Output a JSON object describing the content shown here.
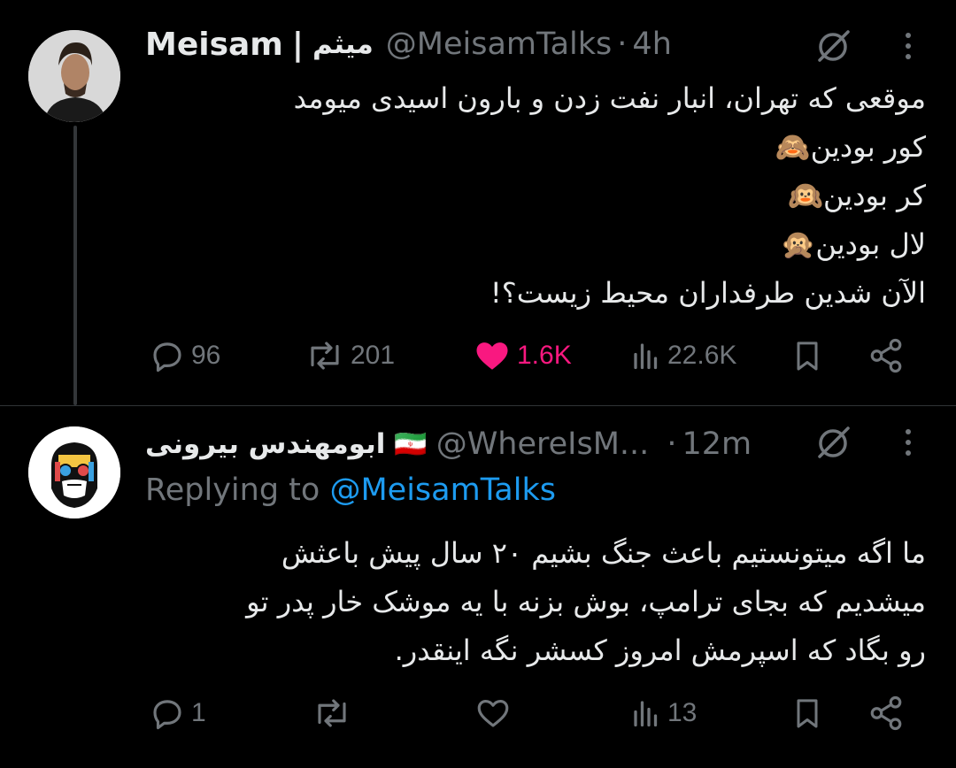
{
  "tweet_main": {
    "display_name": "Meisam",
    "separator": "|",
    "display_name_fa": "میثم",
    "handle": "@MeisamTalks",
    "dot": "·",
    "time": "4h",
    "lines": [
      "موقعی که تهران، انبار نفت زدن و بارون اسیدی میومد",
      "کور بودین🙈",
      "کر بودین🙉",
      "لال بودین🙊",
      "الآن شدین طرفداران محیط زیست؟!"
    ],
    "replies": "96",
    "reposts": "201",
    "likes": "1.6K",
    "views": "22.6K",
    "liked": true
  },
  "tweet_reply": {
    "display_name": "ابومهندس بیرونی",
    "flag": "🇮🇷",
    "handle": "@WhereIsM...",
    "dot": "·",
    "time": "12m",
    "replying_prefix": "Replying to",
    "replying_to": "@MeisamTalks",
    "lines": [
      "ما اگه میتونستیم باعث جنگ بشیم ۲۰ سال پیش باعثش",
      "میشدیم که بجای ترامپ، بوش بزنه با یه موشک خار پدر تو",
      "رو بگاد که اسپرمش امروز کسشر نگه اینقدر."
    ],
    "replies": "1",
    "reposts": "",
    "likes": "",
    "views": "13"
  },
  "colors": {
    "background": "#000000",
    "text": "#e7e9ea",
    "muted": "#71767b",
    "link": "#1d9bf0",
    "like": "#f91880",
    "divider": "#2f3336"
  }
}
